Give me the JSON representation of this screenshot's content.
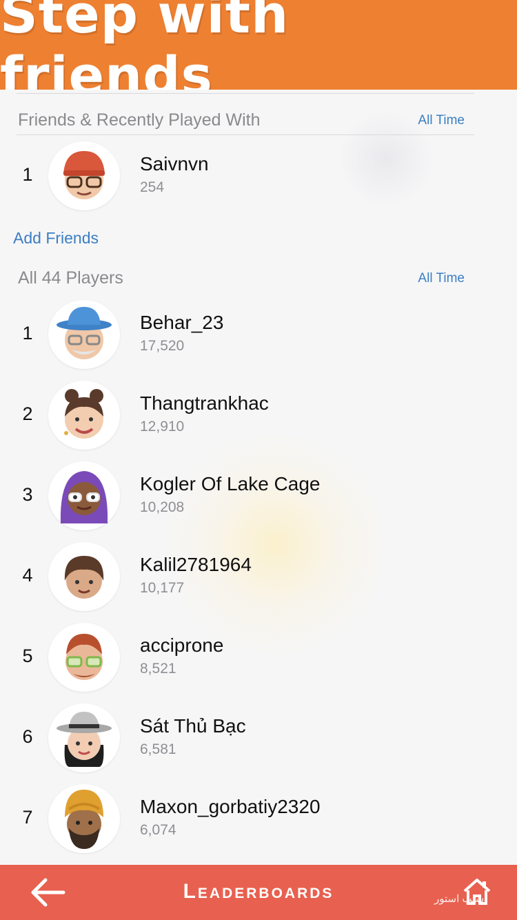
{
  "banner": {
    "title": "Step with friends"
  },
  "friends_section": {
    "title": "Friends & Recently Played With",
    "filter": "All Time",
    "players": [
      {
        "rank": "1",
        "name": "Saivnvn",
        "score": "254",
        "avatar": "memoji-red-beanie-glasses"
      }
    ]
  },
  "add_friends_label": "Add Friends",
  "all_section": {
    "title": "All 44 Players",
    "filter": "All Time",
    "players": [
      {
        "rank": "1",
        "name": "Behar_23",
        "score": "17,520",
        "avatar": "memoji-blue-hat-grandpa"
      },
      {
        "rank": "2",
        "name": "Thangtrankhac",
        "score": "12,910",
        "avatar": "memoji-bun-hair-woman"
      },
      {
        "rank": "3",
        "name": "Kogler Of Lake Cage",
        "score": "10,208",
        "avatar": "memoji-purple-hijab"
      },
      {
        "rank": "4",
        "name": "Kalil2781964",
        "score": "10,177",
        "avatar": "memoji-brown-hair-boy"
      },
      {
        "rank": "5",
        "name": "acciprone",
        "score": "8,521",
        "avatar": "memoji-green-glasses"
      },
      {
        "rank": "6",
        "name": "Sát Thủ Bạc",
        "score": "6,581",
        "avatar": "memoji-grey-hat-woman"
      },
      {
        "rank": "7",
        "name": "Maxon_gorbatiy2320",
        "score": "6,074",
        "avatar": "memoji-turban-beard"
      }
    ]
  },
  "footer": {
    "title": "Leaderboards",
    "back_icon": "back-arrow-icon",
    "home_icon": "home-icon",
    "watermark": "سیب استور"
  },
  "colors": {
    "banner": "#ee8031",
    "footer": "#e8604f",
    "link": "#3a7ec3"
  }
}
